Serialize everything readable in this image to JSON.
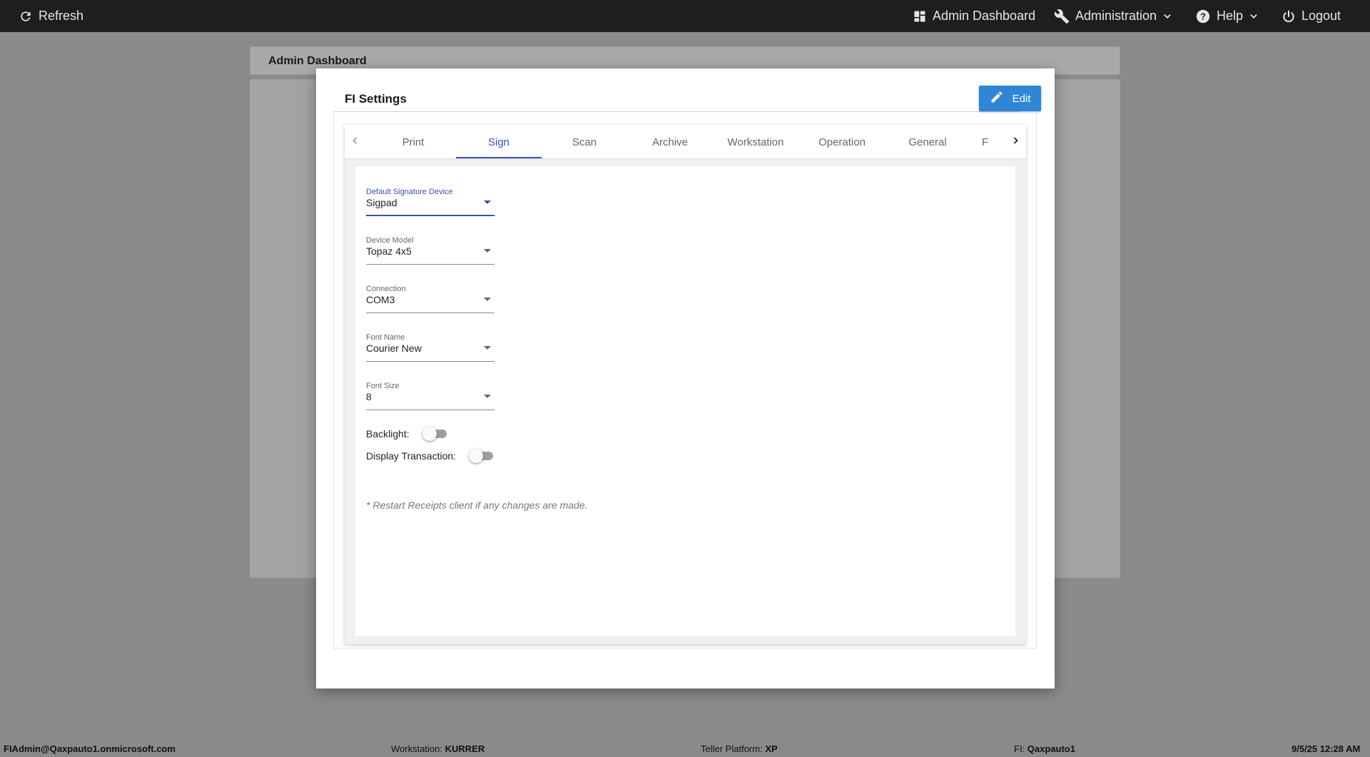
{
  "topbar": {
    "refresh_label": "Refresh",
    "admin_dashboard_label": "Admin Dashboard",
    "administration_label": "Administration",
    "help_label": "Help",
    "logout_label": "Logout"
  },
  "background": {
    "header_title": "Admin Dashboard"
  },
  "modal": {
    "title": "FI Settings",
    "edit_label": "Edit",
    "tabs": [
      {
        "label": "Print",
        "active": false
      },
      {
        "label": "Sign",
        "active": true
      },
      {
        "label": "Scan",
        "active": false
      },
      {
        "label": "Archive",
        "active": false
      },
      {
        "label": "Workstation",
        "active": false
      },
      {
        "label": "Operation",
        "active": false
      },
      {
        "label": "General",
        "active": false
      },
      {
        "label": "F",
        "active": false
      }
    ],
    "fields": {
      "default_signature_device": {
        "label": "Default Signature Device",
        "value": "Sigpad"
      },
      "device_model": {
        "label": "Device Model",
        "value": "Topaz 4x5"
      },
      "connection": {
        "label": "Connection",
        "value": "COM3"
      },
      "font_name": {
        "label": "Font Name",
        "value": "Courier New"
      },
      "font_size": {
        "label": "Font Size",
        "value": "8"
      }
    },
    "toggles": {
      "backlight": {
        "label": "Backlight:",
        "on": false
      },
      "display_transaction": {
        "label": "Display Transaction:",
        "on": false
      }
    },
    "note": "* Restart Receipts client if any changes are made."
  },
  "statusbar": {
    "user": "FIAdmin@Qaxpauto1.onmicrosoft.com",
    "workstation_label": "Workstation:",
    "workstation_value": "KURRER",
    "platform_label": "Teller Platform:",
    "platform_value": "XP",
    "fi_label": "FI:",
    "fi_value": "Qaxpauto1",
    "datetime": "9/5/25 12:28 AM"
  },
  "colors": {
    "accent": "#3b4dbf",
    "edit_button": "#2f86d6",
    "topbar": "#1e1e1e",
    "backdrop": "#8a8a8a"
  }
}
